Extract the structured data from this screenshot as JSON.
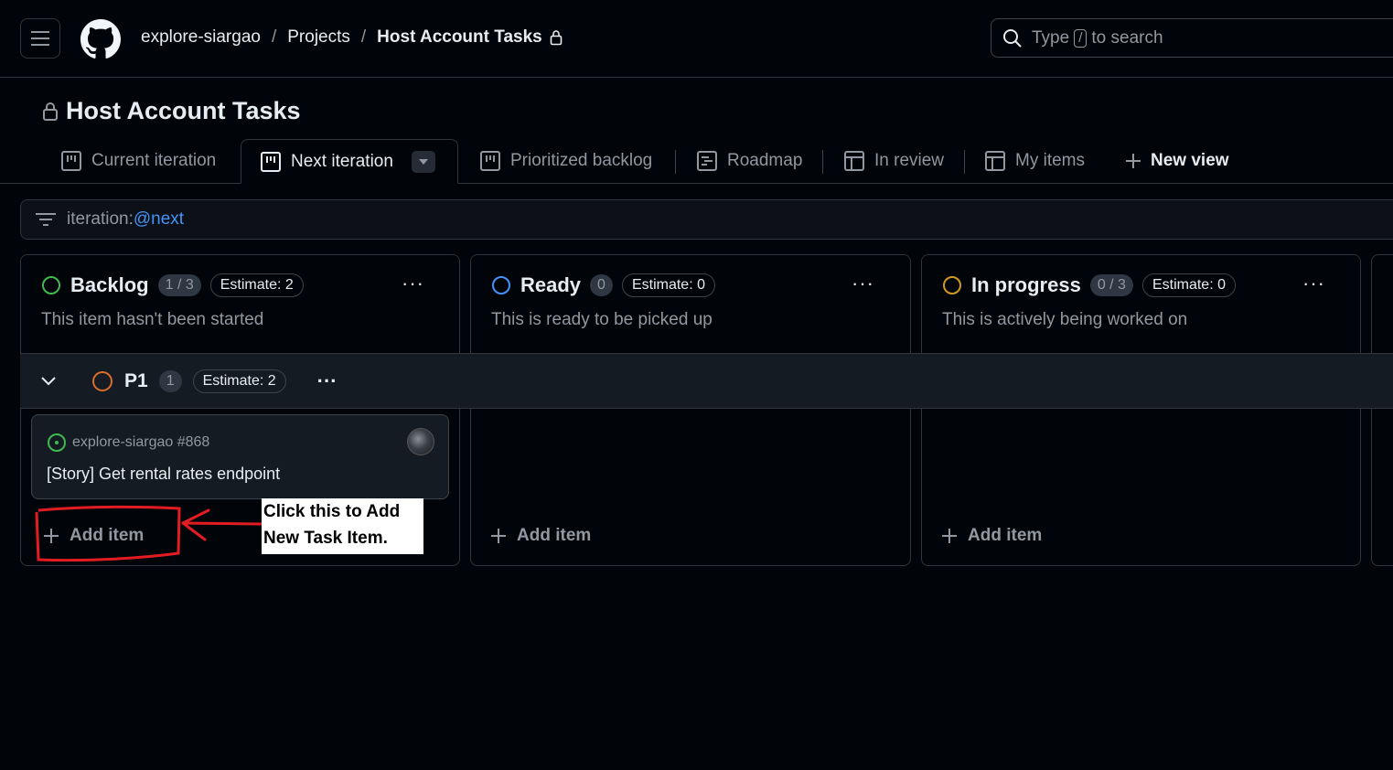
{
  "header": {
    "breadcrumbs": [
      "explore-siargao",
      "Projects",
      "Host Account Tasks"
    ],
    "search_prefix": "Type",
    "search_key": "/",
    "search_suffix": "to search"
  },
  "project": {
    "title": "Host Account Tasks"
  },
  "tabs": [
    {
      "label": "Current iteration",
      "icon": "board-icon",
      "active": false
    },
    {
      "label": "Next iteration",
      "icon": "board-icon",
      "active": true
    },
    {
      "label": "Prioritized backlog",
      "icon": "board-icon",
      "active": false
    },
    {
      "label": "Roadmap",
      "icon": "roadmap-icon",
      "active": false
    },
    {
      "label": "In review",
      "icon": "table-icon",
      "active": false
    },
    {
      "label": "My items",
      "icon": "table-icon",
      "active": false
    }
  ],
  "new_view_label": "New view",
  "filter": {
    "prefix": "iteration:",
    "value": "@next"
  },
  "columns": [
    {
      "name": "Backlog",
      "count": "1 / 3",
      "estimate": "Estimate: 2",
      "description": "This item hasn't been started",
      "status_color": "#3fb950",
      "add_label": "Add item"
    },
    {
      "name": "Ready",
      "count": "0",
      "estimate": "Estimate: 0",
      "description": "This is ready to be picked up",
      "status_color": "#4493f8",
      "add_label": "Add item"
    },
    {
      "name": "In progress",
      "count": "0 / 3",
      "estimate": "Estimate: 0",
      "description": "This is actively being worked on",
      "status_color": "#d29922",
      "add_label": "Add item"
    }
  ],
  "group": {
    "name": "P1",
    "count": "1",
    "estimate": "Estimate: 2",
    "status_color": "#db6d28"
  },
  "card": {
    "repo_ref": "explore-siargao #868",
    "title": "[Story] Get rental rates endpoint"
  },
  "annotation": {
    "line1": "Click this to Add",
    "line2": "New Task Item.",
    "color": "#e31b23"
  },
  "colors": {
    "background": "#010409",
    "border": "#30363d",
    "accent_link": "#4493f8"
  }
}
